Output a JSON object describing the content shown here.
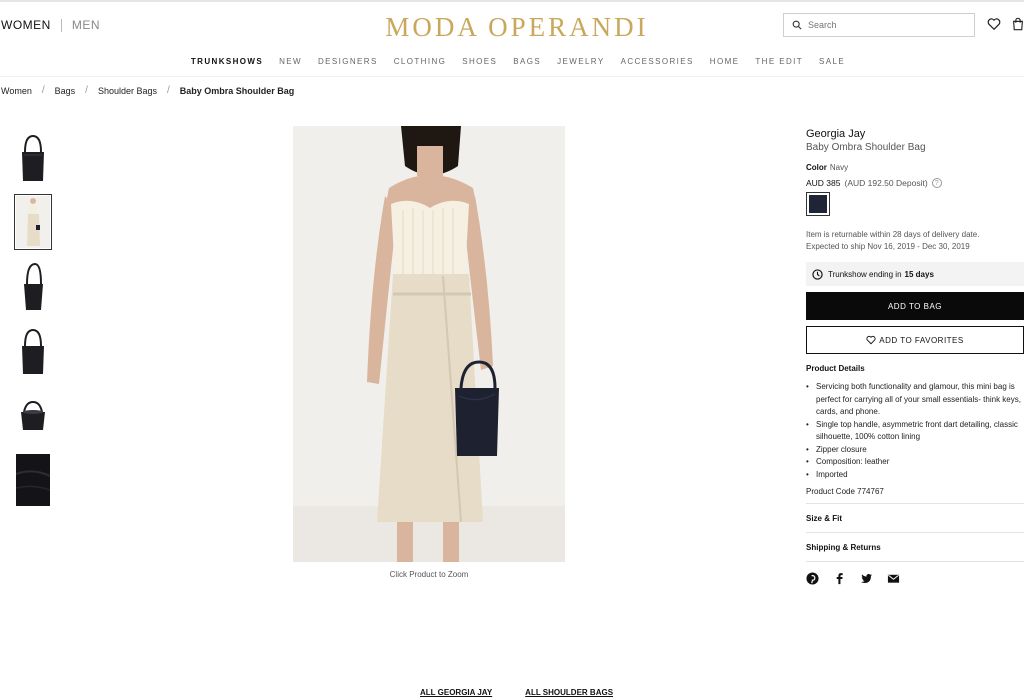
{
  "header": {
    "gender_women": "WOMEN",
    "gender_men": "MEN",
    "logo": "MODA OPERANDI",
    "search_placeholder": "Search"
  },
  "nav": [
    "TRUNKSHOWS",
    "NEW",
    "DESIGNERS",
    "CLOTHING",
    "SHOES",
    "BAGS",
    "JEWELRY",
    "ACCESSORIES",
    "HOME",
    "THE EDIT",
    "SALE"
  ],
  "breadcrumb": [
    "Women",
    "Bags",
    "Shoulder Bags",
    "Baby Ombra Shoulder Bag"
  ],
  "gallery": {
    "thumbnails": [
      "bag-front",
      "model-wearing",
      "bag-side",
      "bag-front-2",
      "bag-top",
      "leather-detail"
    ],
    "selected_index": 1,
    "zoom_hint": "Click Product to Zoom"
  },
  "product": {
    "brand": "Georgia Jay",
    "name": "Baby Ombra Shoulder Bag",
    "color_label": "Color",
    "color_value": "Navy",
    "price": "AUD 385",
    "deposit": "(AUD 192.50 Deposit)",
    "help_glyph": "?",
    "swatch_color": "#1f2536",
    "returns_line1": "Item is returnable within 28 days of delivery date.",
    "returns_line2": "Expected to ship Nov 16, 2019 - Dec 30, 2019",
    "trunkshow_text": "Trunkshow ending in",
    "trunkshow_days": "15 days",
    "add_to_bag": "ADD TO BAG",
    "add_to_favorites": "ADD TO FAVORITES",
    "details_title": "Product Details",
    "details": [
      "Servicing both functionality and glamour, this mini bag is perfect for carrying all of your small essentials- think keys, cards, and phone.",
      "Single top handle, asymmetric front dart detailing, classic silhouette, 100% cotton lining",
      "Zipper closure",
      "Composition: leather",
      "Imported"
    ],
    "product_code": "Product Code 774767",
    "size_fit": "Size & Fit",
    "shipping_returns": "Shipping & Returns"
  },
  "share": [
    "pinterest-icon",
    "facebook-icon",
    "twitter-icon",
    "email-icon"
  ],
  "bottom_links": [
    "ALL GEORGIA JAY",
    "ALL SHOULDER BAGS"
  ],
  "colors": {
    "logo_gold": "#c9a85b",
    "button_black": "#0a0a0a"
  }
}
